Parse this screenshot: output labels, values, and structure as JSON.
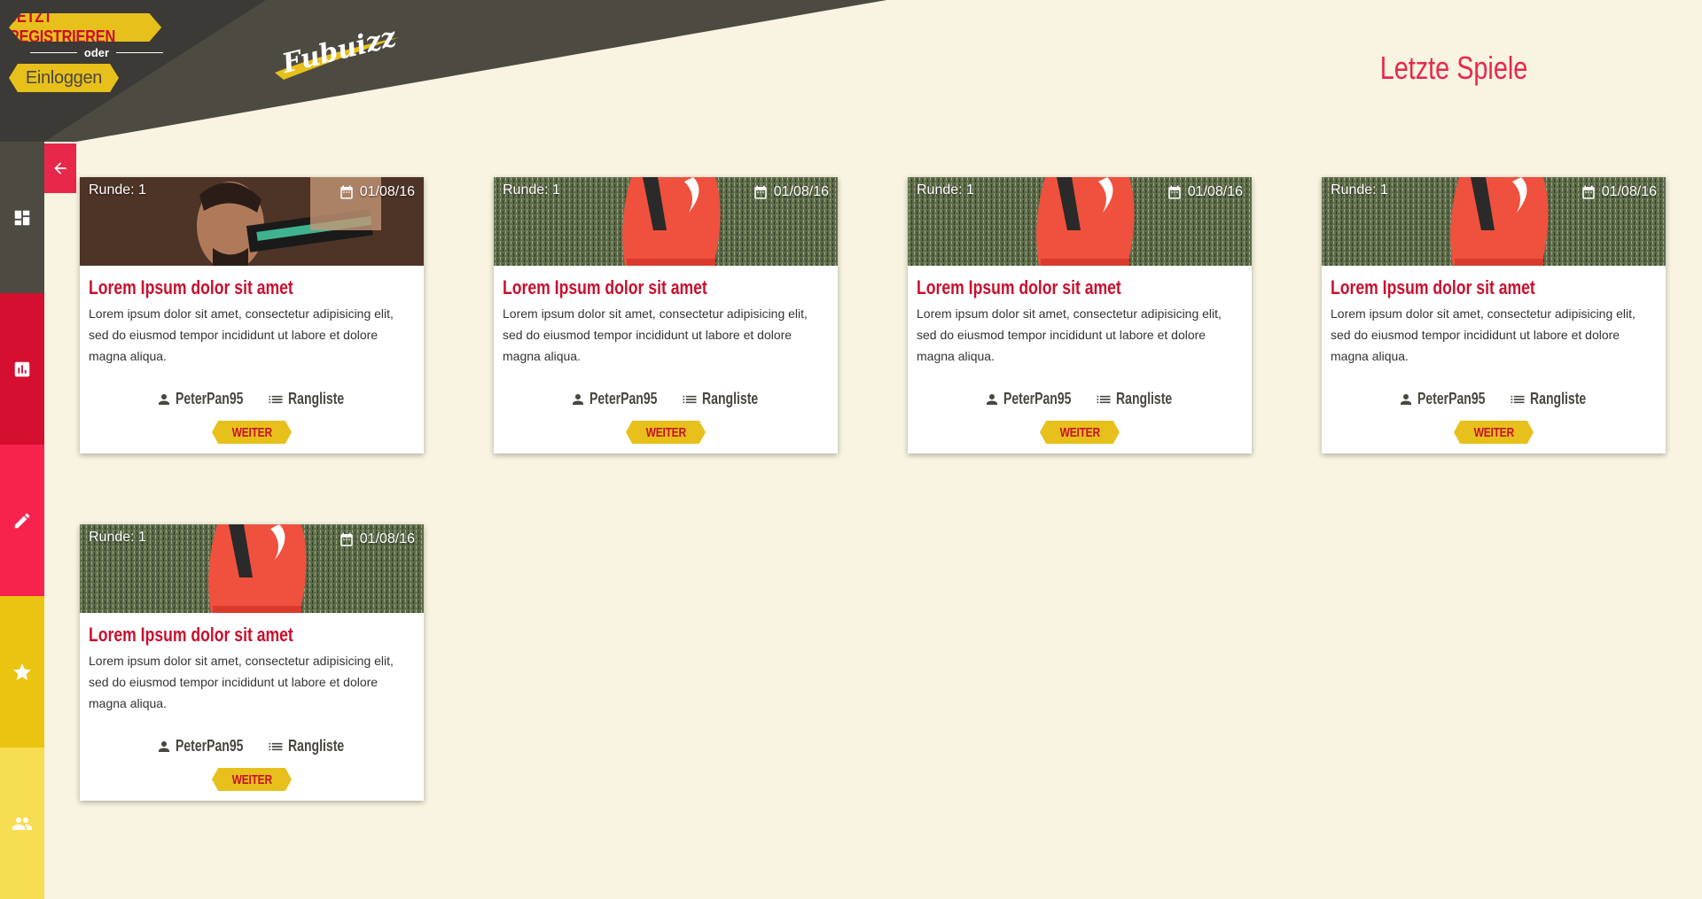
{
  "header": {
    "register_label": "JETZT REGISTRIEREN",
    "or_label": "oder",
    "login_label": "Einloggen",
    "logo_text": "Fubuizz",
    "page_title": "Letzte Spiele"
  },
  "sidebar": {
    "items": [
      {
        "icon": "dashboard-icon",
        "color": "#4d4a42"
      },
      {
        "icon": "bar-chart-icon",
        "color": "#d50f2f"
      },
      {
        "icon": "pencil-icon",
        "color": "#f7234d"
      },
      {
        "icon": "star-icon",
        "color": "#eac410"
      },
      {
        "icon": "group-icon",
        "color": "#f7dd52"
      }
    ]
  },
  "colors": {
    "accent_red": "#c8102e",
    "title_pink": "#e8274b",
    "pill_yellow": "#e8c01b",
    "dark_header": "#3b3a36",
    "background": "#f8f4e1"
  },
  "cards": [
    {
      "round": "Runde: 1",
      "date": "01/08/16",
      "title": "Lorem Ipsum dolor sit amet",
      "text": "Lorem ipsum dolor sit amet, consectetur adipisicing elit, sed do eiusmod tempor incididunt ut labore et dolore magna aliqua.",
      "user": "PeterPan95",
      "ranking": "Rangliste",
      "button": "WEITER",
      "image": "player-photo"
    },
    {
      "round": "Runde: 1",
      "date": "01/08/16",
      "title": "Lorem Ipsum dolor sit amet",
      "text": "Lorem ipsum dolor sit amet, consectetur adipisicing elit, sed do eiusmod tempor incididunt ut labore et dolore magna aliqua.",
      "user": "PeterPan95",
      "ranking": "Rangliste",
      "button": "WEITER",
      "image": "boot-photo"
    },
    {
      "round": "Runde: 1",
      "date": "01/08/16",
      "title": "Lorem Ipsum dolor sit amet",
      "text": "Lorem ipsum dolor sit amet, consectetur adipisicing elit, sed do eiusmod tempor incididunt ut labore et dolore magna aliqua.",
      "user": "PeterPan95",
      "ranking": "Rangliste",
      "button": "WEITER",
      "image": "boot-photo"
    },
    {
      "round": "Runde: 1",
      "date": "01/08/16",
      "title": "Lorem Ipsum dolor sit amet",
      "text": "Lorem ipsum dolor sit amet, consectetur adipisicing elit, sed do eiusmod tempor incididunt ut labore et dolore magna aliqua.",
      "user": "PeterPan95",
      "ranking": "Rangliste",
      "button": "WEITER",
      "image": "boot-photo"
    },
    {
      "round": "Runde: 1",
      "date": "01/08/16",
      "title": "Lorem Ipsum dolor sit amet",
      "text": "Lorem ipsum dolor sit amet, consectetur adipisicing elit, sed do eiusmod tempor incididunt ut labore et dolore magna aliqua.",
      "user": "PeterPan95",
      "ranking": "Rangliste",
      "button": "WEITER",
      "image": "boot-photo"
    }
  ]
}
